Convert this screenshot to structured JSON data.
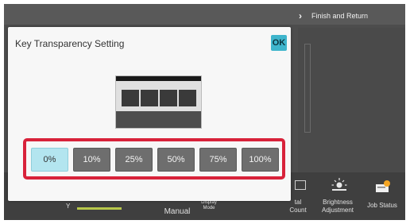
{
  "background": {
    "finish_return": "Finish and Return",
    "bottom_bar": {
      "y_label": "Y",
      "manual_label": "Manual",
      "display_mode_label": "Display Mode",
      "count_label": "tal Count",
      "brightness_label": "Brightness Adjustment",
      "job_status_label": "Job Status"
    }
  },
  "dialog": {
    "title": "Key Transparency Setting",
    "ok_label": "OK",
    "options": [
      "0%",
      "10%",
      "25%",
      "50%",
      "75%",
      "100%"
    ],
    "selected_index": 0
  },
  "colors": {
    "accent": "#3fb5cc",
    "selected_option": "#b3e5ef",
    "option": "#6e6e6e",
    "highlight_frame": "#d8223a"
  }
}
